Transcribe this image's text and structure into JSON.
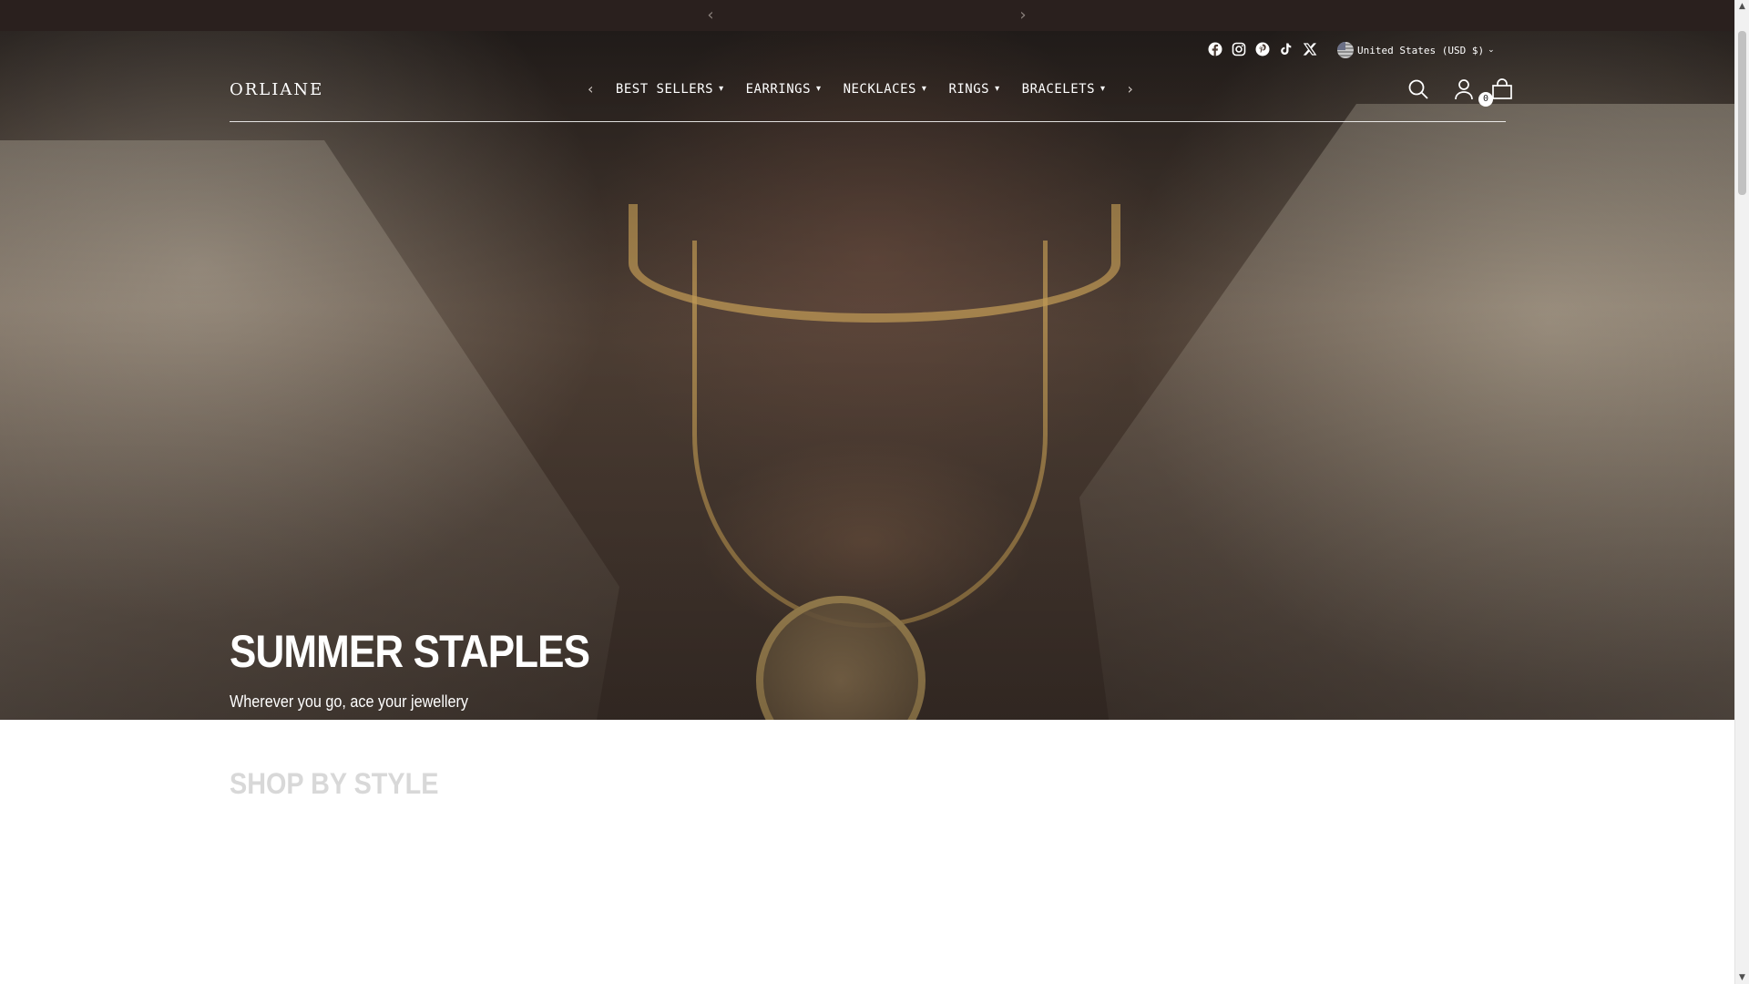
{
  "announcement": {
    "prev_icon": "chevron-left-icon",
    "next_icon": "chevron-right-icon"
  },
  "header": {
    "logo": "ORLIANE",
    "social": [
      "facebook-icon",
      "instagram-icon",
      "pinterest-icon",
      "tiktok-icon",
      "x-twitter-icon"
    ],
    "currency_label": "United States (USD $)",
    "nav": [
      {
        "label": "BEST SELLERS"
      },
      {
        "label": "EARRINGS"
      },
      {
        "label": "NECKLACES"
      },
      {
        "label": "RINGS"
      },
      {
        "label": "BRACELETS"
      }
    ],
    "cart_count": "0"
  },
  "hero": {
    "title": "SUMMER STAPLES",
    "subtitle": "Wherever you go, ace your jewellery"
  },
  "sections": {
    "shop_by_style": "SHOP BY STYLE"
  },
  "colors": {
    "announcement_bg": "#2a201e",
    "text_on_hero": "#ffffff",
    "section_title": "#d8d8d8"
  }
}
